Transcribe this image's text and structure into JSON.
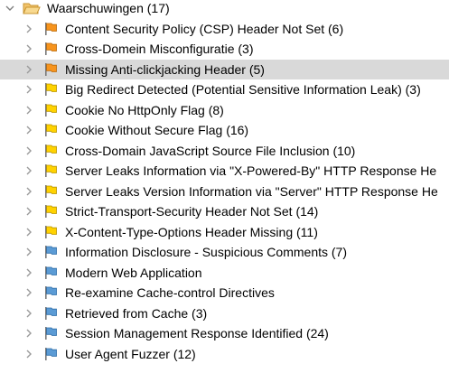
{
  "colors": {
    "selected_row": "#d9d9d9",
    "chevron": "#9a9a9a",
    "folder": "#f2c36b",
    "folder_edge": "#c99531",
    "flag_orange": "#f7941d",
    "flag_orange_edge": "#b86a0c",
    "flag_yellow": "#ffd200",
    "flag_yellow_edge": "#b89400",
    "flag_blue": "#5b9bd5",
    "flag_blue_edge": "#2f6ea8",
    "flag_pole": "#7a7a7a"
  },
  "tree": {
    "root": {
      "label": "Waarschuwingen (17)",
      "icon": "open-folder-icon",
      "expanded": true
    },
    "items": [
      {
        "label": "Content Security Policy (CSP) Header Not Set (6)",
        "risk": "orange",
        "icon": "orange-flag-icon",
        "selected": false
      },
      {
        "label": "Cross-Domein Misconfiguratie (3)",
        "risk": "orange",
        "icon": "orange-flag-icon",
        "selected": false
      },
      {
        "label": "Missing Anti-clickjacking Header (5)",
        "risk": "orange",
        "icon": "orange-flag-icon",
        "selected": true
      },
      {
        "label": "Big Redirect Detected (Potential Sensitive Information Leak) (3)",
        "risk": "yellow",
        "icon": "yellow-flag-icon",
        "selected": false
      },
      {
        "label": "Cookie No HttpOnly Flag (8)",
        "risk": "yellow",
        "icon": "yellow-flag-icon",
        "selected": false
      },
      {
        "label": "Cookie Without Secure Flag (16)",
        "risk": "yellow",
        "icon": "yellow-flag-icon",
        "selected": false
      },
      {
        "label": "Cross-Domain JavaScript Source File Inclusion (10)",
        "risk": "yellow",
        "icon": "yellow-flag-icon",
        "selected": false
      },
      {
        "label": "Server Leaks Information via \"X-Powered-By\" HTTP Response He",
        "risk": "yellow",
        "icon": "yellow-flag-icon",
        "selected": false
      },
      {
        "label": "Server Leaks Version Information via \"Server\" HTTP Response He",
        "risk": "yellow",
        "icon": "yellow-flag-icon",
        "selected": false
      },
      {
        "label": "Strict-Transport-Security Header Not Set (14)",
        "risk": "yellow",
        "icon": "yellow-flag-icon",
        "selected": false
      },
      {
        "label": "X-Content-Type-Options Header Missing (11)",
        "risk": "yellow",
        "icon": "yellow-flag-icon",
        "selected": false
      },
      {
        "label": "Information Disclosure - Suspicious Comments (7)",
        "risk": "blue",
        "icon": "blue-flag-icon",
        "selected": false
      },
      {
        "label": "Modern Web Application",
        "risk": "blue",
        "icon": "blue-flag-icon",
        "selected": false
      },
      {
        "label": "Re-examine Cache-control Directives",
        "risk": "blue",
        "icon": "blue-flag-icon",
        "selected": false
      },
      {
        "label": "Retrieved from Cache (3)",
        "risk": "blue",
        "icon": "blue-flag-icon",
        "selected": false
      },
      {
        "label": "Session Management Response Identified (24)",
        "risk": "blue",
        "icon": "blue-flag-icon",
        "selected": false
      },
      {
        "label": "User Agent Fuzzer (12)",
        "risk": "blue",
        "icon": "blue-flag-icon",
        "selected": false
      }
    ]
  }
}
